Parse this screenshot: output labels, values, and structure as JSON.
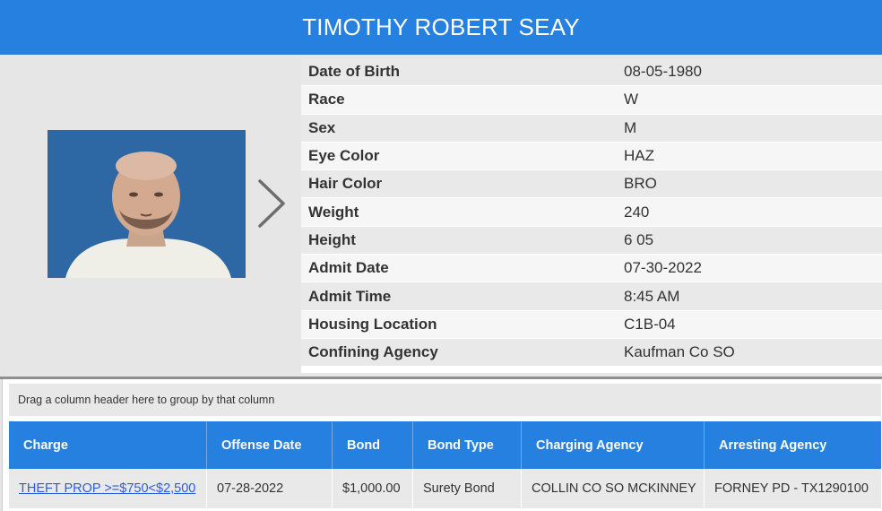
{
  "header": {
    "title": "TIMOTHY ROBERT SEAY"
  },
  "details": [
    {
      "label": "Date of Birth",
      "value": "08-05-1980"
    },
    {
      "label": "Race",
      "value": "W"
    },
    {
      "label": "Sex",
      "value": "M"
    },
    {
      "label": "Eye Color",
      "value": "HAZ"
    },
    {
      "label": "Hair Color",
      "value": "BRO"
    },
    {
      "label": "Weight",
      "value": "240"
    },
    {
      "label": "Height",
      "value": "6 05"
    },
    {
      "label": "Admit Date",
      "value": "07-30-2022"
    },
    {
      "label": "Admit Time",
      "value": "8:45 AM"
    },
    {
      "label": "Housing Location",
      "value": "C1B-04"
    },
    {
      "label": "Confining Agency",
      "value": "Kaufman Co SO"
    }
  ],
  "grid": {
    "group_hint": "Drag a column header here to group by that column",
    "columns": [
      "Charge",
      "Offense Date",
      "Bond",
      "Bond Type",
      "Charging Agency",
      "Arresting Agency"
    ],
    "rows": [
      [
        "THEFT PROP >=$750<$2,500",
        "07-28-2022",
        "$1,000.00",
        "Surety Bond",
        "COLLIN CO SO MCKINNEY",
        "FORNEY PD - TX1290100"
      ]
    ]
  },
  "icons": {
    "photo_next": "chevron-right-icon"
  },
  "colors": {
    "accent": "#2680e0",
    "link": "#2a5fd8"
  }
}
